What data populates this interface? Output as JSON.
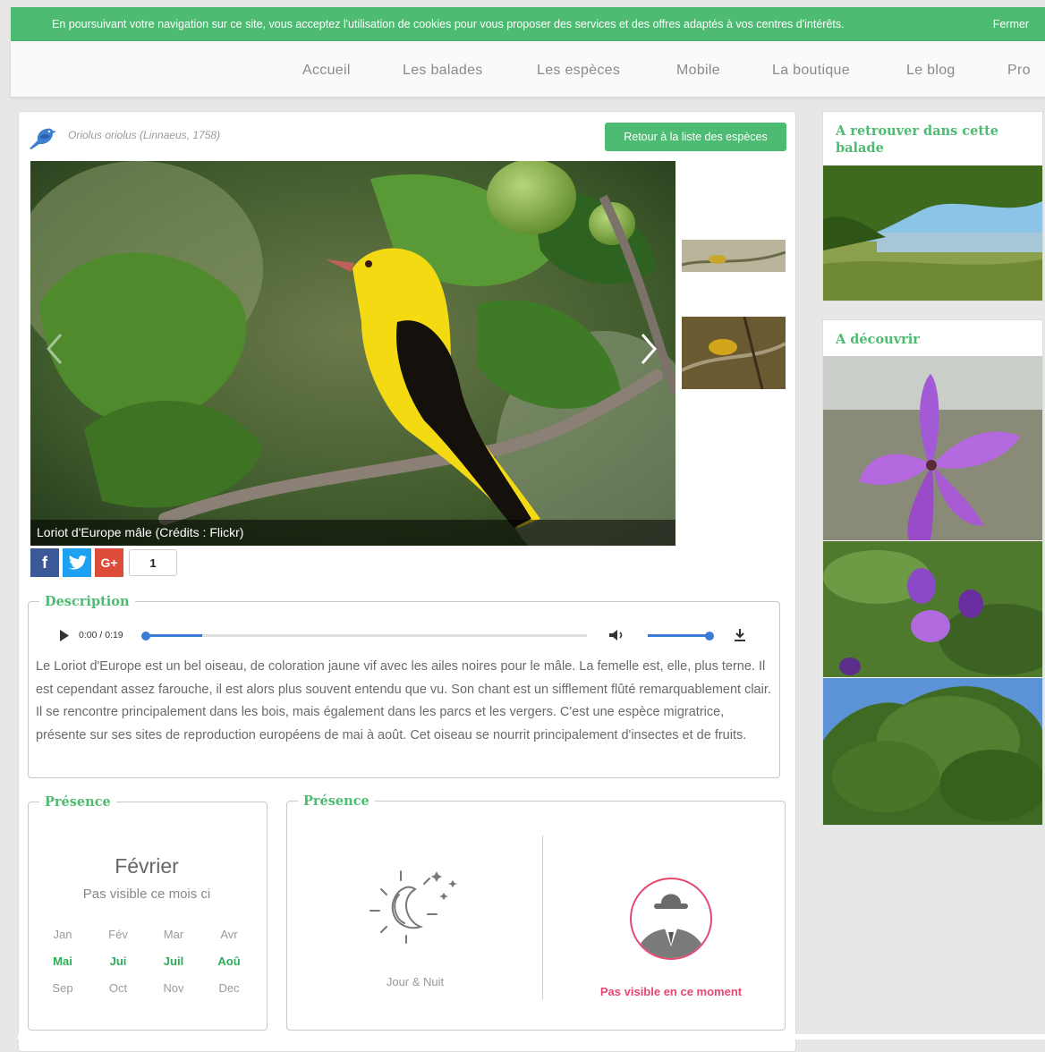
{
  "cookie": {
    "message": "En poursuivant votre navigation sur ce site, vous acceptez l'utilisation de cookies pour vous proposer des services et des offres adaptés à vos centres d'intérêts.",
    "close_label": "Fermer"
  },
  "nav": {
    "items": [
      "Accueil",
      "Les balades",
      "Les espèces",
      "Mobile",
      "La boutique",
      "Le blog",
      "Pro"
    ]
  },
  "species": {
    "scientific_name": "Oriolus oriolus (Linnaeus, 1758)",
    "back_button": "Retour à la liste des espèces",
    "photo_caption": "Loriot d'Europe mâle (Crédits : Flickr)",
    "share_count": "1"
  },
  "description": {
    "legend": "Description",
    "audio_time": "0:00 / 0:19",
    "audio_progress": 0.0,
    "volume_level": 1.0,
    "text": "Le Loriot d'Europe est un bel oiseau, de coloration jaune vif avec les ailes noires pour le mâle. La femelle est, elle, plus terne. Il est cependant assez farouche, il est alors plus souvent entendu que vu. Son chant est un sifflement flûté remarquablement clair. Il se rencontre principalement dans les bois, mais également dans les parcs et les vergers. C'est une espèce migratrice, présente sur ses sites de reproduction européens de mai à août. Cet oiseau se nourrit principalement d'insectes et de fruits."
  },
  "presence_month": {
    "legend": "Présence",
    "current_month": "Février",
    "status": "Pas visible ce mois ci",
    "months": [
      {
        "label": "Jan",
        "active": false
      },
      {
        "label": "Fév",
        "active": false
      },
      {
        "label": "Mar",
        "active": false
      },
      {
        "label": "Avr",
        "active": false
      },
      {
        "label": "Mai",
        "active": true
      },
      {
        "label": "Jui",
        "active": true
      },
      {
        "label": "Juil",
        "active": true
      },
      {
        "label": "Aoû",
        "active": true
      },
      {
        "label": "Sep",
        "active": false
      },
      {
        "label": "Oct",
        "active": false
      },
      {
        "label": "Nov",
        "active": false
      },
      {
        "label": "Dec",
        "active": false
      }
    ]
  },
  "presence_time": {
    "legend": "Présence",
    "time_label": "Jour & Nuit",
    "visibility_label": "Pas visible en ce moment"
  },
  "sidebar": {
    "retrouver_title": "A retrouver dans cette balade",
    "decouvrir_title": "A découvrir"
  },
  "colors": {
    "accent": "#4dbb71",
    "alert": "#e5476f"
  }
}
